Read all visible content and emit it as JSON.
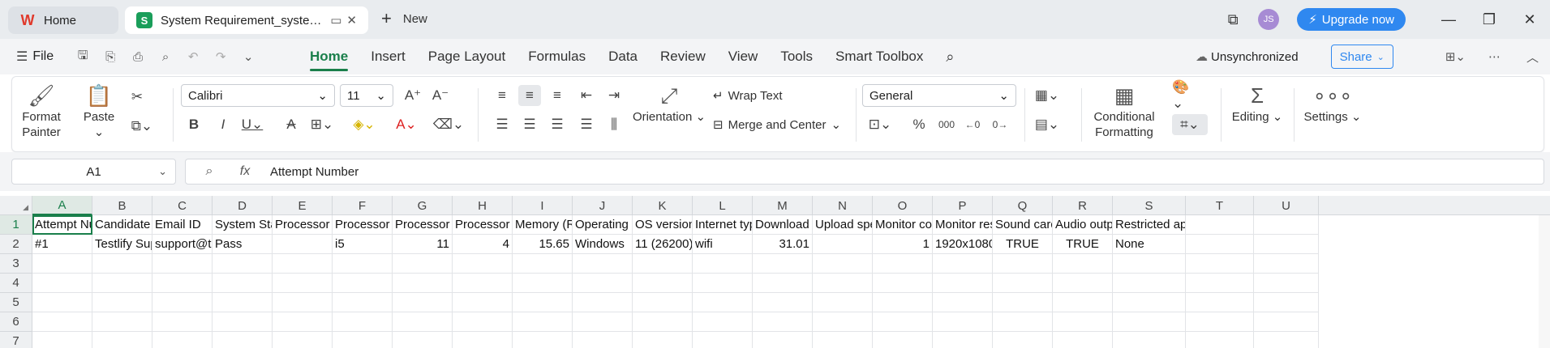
{
  "tabs": {
    "home_label": "Home",
    "doc_label": "System Requirement_system-requirement",
    "new_label": "New"
  },
  "user": {
    "initials": "JS"
  },
  "upgrade_label": "Upgrade now",
  "menu": {
    "file": "File",
    "tabs": [
      "Home",
      "Insert",
      "Page Layout",
      "Formulas",
      "Data",
      "Review",
      "View",
      "Tools",
      "Smart Toolbox"
    ],
    "sync_status": "Unsynchronized",
    "share": "Share"
  },
  "ribbon": {
    "format_painter": "Format Painter",
    "paste": "Paste",
    "font_name": "Calibri",
    "font_size": "11",
    "wrap_text": "Wrap Text",
    "orientation": "Orientation",
    "merge_center": "Merge and Center",
    "number_format": "General",
    "percent": "%",
    "thousands": "000",
    "conditional_formatting": "Conditional Formatting",
    "editing": "Editing",
    "settings": "Settings"
  },
  "formula_bar": {
    "name_box": "A1",
    "fx": "fx",
    "value": "Attempt Number"
  },
  "sheet": {
    "columns": [
      "A",
      "B",
      "C",
      "D",
      "E",
      "F",
      "G",
      "H",
      "I",
      "J",
      "K",
      "L",
      "M",
      "N",
      "O",
      "P",
      "Q",
      "R",
      "S",
      "T",
      "U"
    ],
    "rows": [
      "1",
      "2",
      "3",
      "4",
      "5",
      "6",
      "7"
    ],
    "header_row": [
      "Attempt Number",
      "Candidate name",
      "Email ID",
      "System Status",
      "Processor vendor",
      "Processor series",
      "Processor generation",
      "Processor cores",
      "Memory (RAM)",
      "Operating system",
      "OS version",
      "Internet type",
      "Download speed",
      "Upload speed",
      "Monitor count",
      "Monitor resolution",
      "Sound card",
      "Audio output",
      "Restricted applications",
      "",
      ""
    ],
    "data_row": [
      "#1",
      "Testlify Support",
      "support@testlify.com",
      "Pass",
      "",
      "i5",
      "11",
      "4",
      "15.65",
      "Windows",
      "11 (26200)",
      "wifi",
      "31.01",
      "",
      "1",
      "1920x1080",
      "TRUE",
      "TRUE",
      "None",
      "",
      ""
    ]
  },
  "colors": {
    "accent": "#1a7f4b",
    "upgrade": "#2f88f0",
    "sheet_icon": "#1a9e5a",
    "wps_red": "#e0392b"
  }
}
